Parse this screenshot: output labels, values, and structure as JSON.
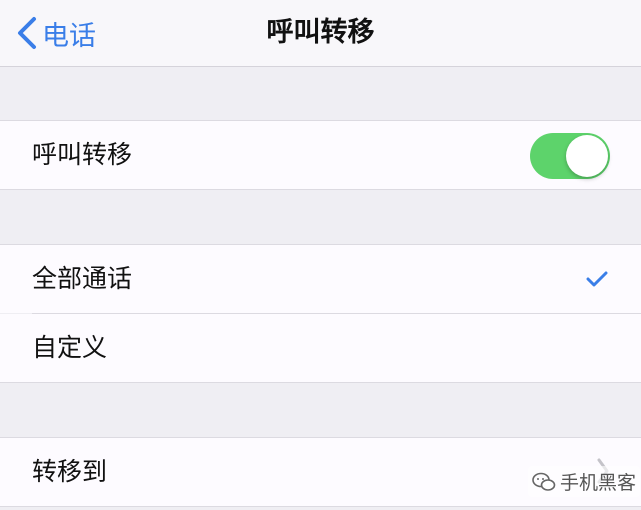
{
  "nav": {
    "back_label": "电话",
    "title": "呼叫转移"
  },
  "forwarding": {
    "label": "呼叫转移",
    "toggle_on": true,
    "toggle_color": "#5dd36b"
  },
  "scope_options": [
    {
      "label": "全部通话",
      "selected": true
    },
    {
      "label": "自定义",
      "selected": false
    }
  ],
  "forward_to": {
    "label": "转移到"
  },
  "watermark": {
    "text": "手机黑客",
    "icon": "wechat-icon"
  },
  "colors": {
    "accent": "#3a7ee8",
    "checkmark": "#3a7ee8",
    "background": "#efeef3"
  }
}
